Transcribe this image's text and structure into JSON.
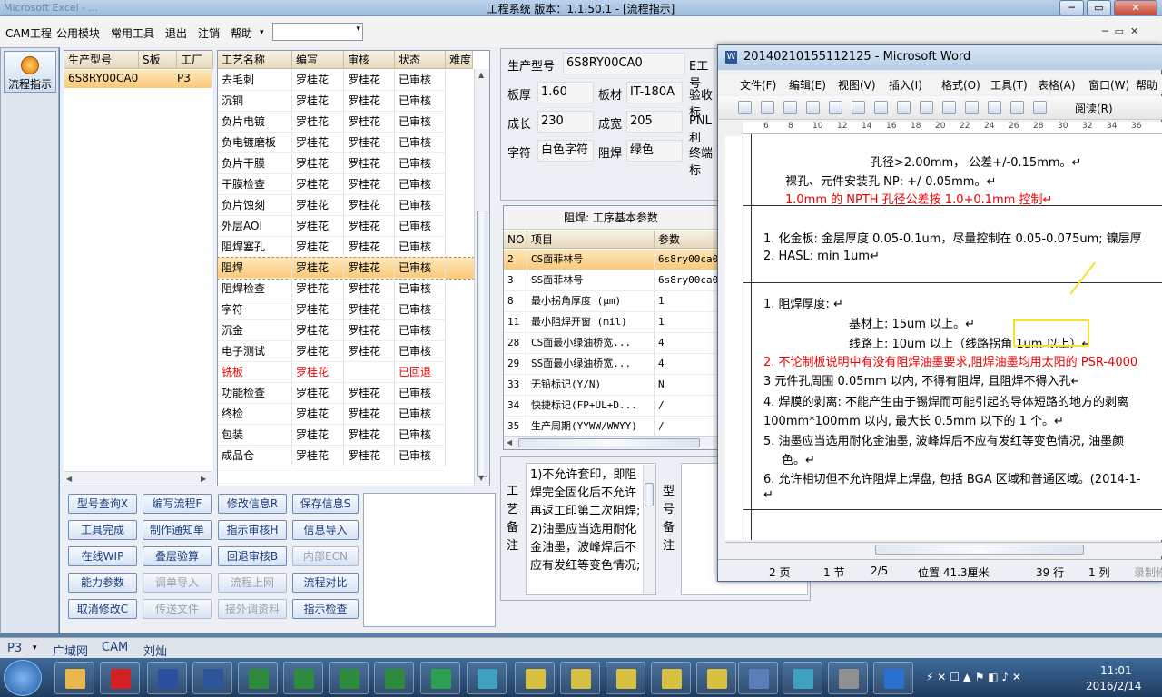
{
  "window": {
    "title": "工程系统  版本：1.1.50.1 - [流程指示]",
    "ghost": "Microsoft Excel - ..."
  },
  "menu": [
    "CAM工程",
    "公用模块",
    "常用工具",
    "退出",
    "注销",
    "帮助"
  ],
  "menu_arrow": "▾",
  "combo_arrow": "▾",
  "nav": {
    "flow_label": "流程指示"
  },
  "left_table": {
    "headers": [
      "生产型号",
      "S板",
      "工厂"
    ],
    "row": [
      "6S8RY00CA0",
      "",
      "P3"
    ]
  },
  "proc_table": {
    "headers": [
      "工艺名称",
      "编写",
      "审核",
      "状态",
      "难度"
    ],
    "rows": [
      [
        "去毛刺",
        "罗桂花",
        "罗桂花",
        "已审核"
      ],
      [
        "沉铜",
        "罗桂花",
        "罗桂花",
        "已审核"
      ],
      [
        "负片电镀",
        "罗桂花",
        "罗桂花",
        "已审核"
      ],
      [
        "负电镀磨板",
        "罗桂花",
        "罗桂花",
        "已审核"
      ],
      [
        "负片干膜",
        "罗桂花",
        "罗桂花",
        "已审核"
      ],
      [
        "干膜检查",
        "罗桂花",
        "罗桂花",
        "已审核"
      ],
      [
        "负片蚀刻",
        "罗桂花",
        "罗桂花",
        "已审核"
      ],
      [
        "外层AOI",
        "罗桂花",
        "罗桂花",
        "已审核"
      ],
      [
        "阻焊塞孔",
        "罗桂花",
        "罗桂花",
        "已审核"
      ],
      [
        "阻焊",
        "罗桂花",
        "罗桂花",
        "已审核"
      ],
      [
        "阻焊检查",
        "罗桂花",
        "罗桂花",
        "已审核"
      ],
      [
        "字符",
        "罗桂花",
        "罗桂花",
        "已审核"
      ],
      [
        "沉金",
        "罗桂花",
        "罗桂花",
        "已审核"
      ],
      [
        "电子测试",
        "罗桂花",
        "罗桂花",
        "已审核"
      ],
      [
        "铣板",
        "罗桂花",
        "",
        "已回退"
      ],
      [
        "功能检查",
        "罗桂花",
        "罗桂花",
        "已审核"
      ],
      [
        "终检",
        "罗桂花",
        "罗桂花",
        "已审核"
      ],
      [
        "包装",
        "罗桂花",
        "罗桂花",
        "已审核"
      ],
      [
        "成品仓",
        "罗桂花",
        "罗桂花",
        "已审核"
      ]
    ]
  },
  "buttons": [
    [
      "型号查询X",
      "编写流程F",
      "修改信息R",
      "保存信息S"
    ],
    [
      "工具完成",
      "制作通知单",
      "指示审核H",
      "信息导入"
    ],
    [
      "在线WIP",
      "叠层验算",
      "回退审核B",
      "内部ECN"
    ],
    [
      "能力参数",
      "调单导入",
      "流程上网",
      "流程对比"
    ],
    [
      "取消修改C",
      "传送文件",
      "接外调资料",
      "指示检查"
    ]
  ],
  "disabled_buttons": [
    "内部ECN",
    "调单导入",
    "流程上网",
    "传送文件",
    "接外调资料"
  ],
  "info": {
    "model_label": "生产型号",
    "model_value": "6S8RY00CA0",
    "e_label": "E工号",
    "thick_label": "板厚",
    "thick_value": "1.60",
    "mat_label": "板材",
    "mat_value": "IT-180A",
    "check_label": "验收标",
    "len_label": "成长",
    "len_value": "230",
    "wid_label": "成宽",
    "wid_value": "205",
    "pnl_label": "PNL利",
    "char_label": "字符",
    "char_value": "白色字符",
    "sm_label": "阻焊",
    "sm_value": "绿色",
    "end_label": "终端标"
  },
  "params": {
    "title": "阻焊: 工序基本参数",
    "headers": [
      "NO",
      "项目",
      "参数"
    ],
    "rows": [
      [
        "2",
        "CS面菲林号",
        "6s8ry00ca0"
      ],
      [
        "3",
        "SS面菲林号",
        "6s8ry00ca0"
      ],
      [
        "8",
        "最小拐角厚度 (μm)",
        "1"
      ],
      [
        "11",
        "最小阻焊开窗 (mil)",
        "1"
      ],
      [
        "28",
        "CS面最小绿油桥宽...",
        "4"
      ],
      [
        "29",
        "SS面最小绿油桥宽...",
        "4"
      ],
      [
        "33",
        "无铅标记(Y/N)",
        "N"
      ],
      [
        "34",
        "快捷标记(FP+UL+D...",
        "/"
      ],
      [
        "35",
        "生产周期(YYWW/WWYY)",
        "/"
      ]
    ]
  },
  "remark": {
    "label": "工艺备注",
    "text": "1)不允许套印，即阻焊完全固化后不允许再返工印第二次阻焊; 2)油墨应当选用耐化金油墨，波峰焊后不应有发红等变色情况;",
    "model_note_label": "型号备注"
  },
  "word": {
    "title": "20140210155112125 - Microsoft Word",
    "menu": [
      "文件(F)",
      "编辑(E)",
      "视图(V)",
      "插入(I)",
      "格式(O)",
      "工具(T)",
      "表格(A)",
      "窗口(W)",
      "帮助"
    ],
    "read_label": "阅读(R)",
    "ruler": [
      "6",
      "8",
      "10",
      "12",
      "14",
      "16",
      "18",
      "20",
      "22",
      "24",
      "26",
      "28",
      "30",
      "32",
      "34",
      "36"
    ],
    "lines": [
      "孔径>2.00mm，  公差+/-0.15mm。↵",
      "裸孔、元件安装孔 NP: +/-0.05mm。↵",
      "1.0mm 的 NPTH 孔径公差按 1.0+0.1mm 控制↵",
      "1.  化金板: 金层厚度 0.05-0.1um，尽量控制在 0.05-0.075um; 镍层厚",
      "2.  HASL: min 1um↵",
      "1.  阻焊厚度: ↵",
      "基材上: 15um 以上。↵",
      "线路上: 10um 以上（线路拐角 1um 以上）↵",
      "2.  不论制板说明中有没有阻焊油墨要求,阻焊油墨均用太阳的 PSR-4000",
      "3   元件孔周围 0.05mm 以内, 不得有阻焊, 且阻焊不得入孔↵",
      "4. 焊膜的剥离: 不能产生由于锡焊而可能引起的导体短路的地方的剥离",
      "100mm*100mm 以内, 最大长 0.5mm 以下的 1 个。↵",
      "5. 油墨应当选用耐化金油墨, 波峰焊后不应有发红等变色情况, 油墨颜",
      "色。↵",
      "6. 允许相切但不允许阻焊上焊盘, 包括 BGA 区域和普通区域。(2014-1-",
      "↵"
    ],
    "status": [
      "2 页",
      "1 节",
      "2/5",
      "位置 41.3厘米",
      "39 行",
      "1 列",
      "录制",
      "修"
    ]
  },
  "statusbar": [
    "P3",
    "广域网",
    "CAM",
    "刘灿"
  ],
  "clock": {
    "time": "11:01",
    "date": "2016/2/14"
  },
  "colors": {
    "selection": "#f9c978",
    "header": "#e6d9bd",
    "accent": "#1d3d80",
    "red": "#e00000"
  }
}
